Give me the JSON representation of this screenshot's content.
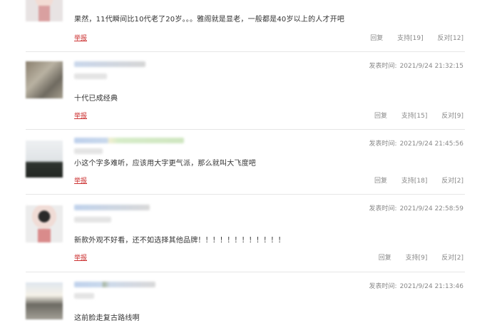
{
  "comments": [
    {
      "time_label": "",
      "time_value": "",
      "text": "果然，11代瞬间比10代老了20岁。。。雅阁就是显老，一般都是40岁以上的人才开吧",
      "report": "举报",
      "reply": "回复",
      "support": "支持[19]",
      "oppose": "反对[12]"
    },
    {
      "time_label": "发表时间:",
      "time_value": "2021/9/24 21:32:15",
      "text": "十代已成经典",
      "report": "举报",
      "reply": "回复",
      "support": "支持[15]",
      "oppose": "反对[9]"
    },
    {
      "time_label": "发表时间:",
      "time_value": "2021/9/24 21:45:56",
      "text": "小这个字多难听，应该用大字更气派，那么就叫大飞度吧",
      "report": "举报",
      "reply": "回复",
      "support": "支持[18]",
      "oppose": "反对[2]"
    },
    {
      "time_label": "发表时间:",
      "time_value": "2021/9/24 22:58:59",
      "text": "新款外观不好看，还不如选择其他品牌！！！！！！！！！！！！",
      "report": "举报",
      "reply": "回复",
      "support": "支持[9]",
      "oppose": "反对[2]"
    },
    {
      "time_label": "发表时间:",
      "time_value": "2021/9/24 21:13:46",
      "text": "这前脸走复古路线啊",
      "report": "",
      "reply": "",
      "support": "",
      "oppose": ""
    }
  ],
  "icons": {
    "avatars": [
      "avatar-icon",
      "avatar-icon",
      "avatar-icon",
      "avatar-icon",
      "avatar-icon"
    ]
  },
  "colors": {
    "report": "#cc3333",
    "meta": "#888888",
    "text": "#333333",
    "divider": "#e6e6e6"
  }
}
